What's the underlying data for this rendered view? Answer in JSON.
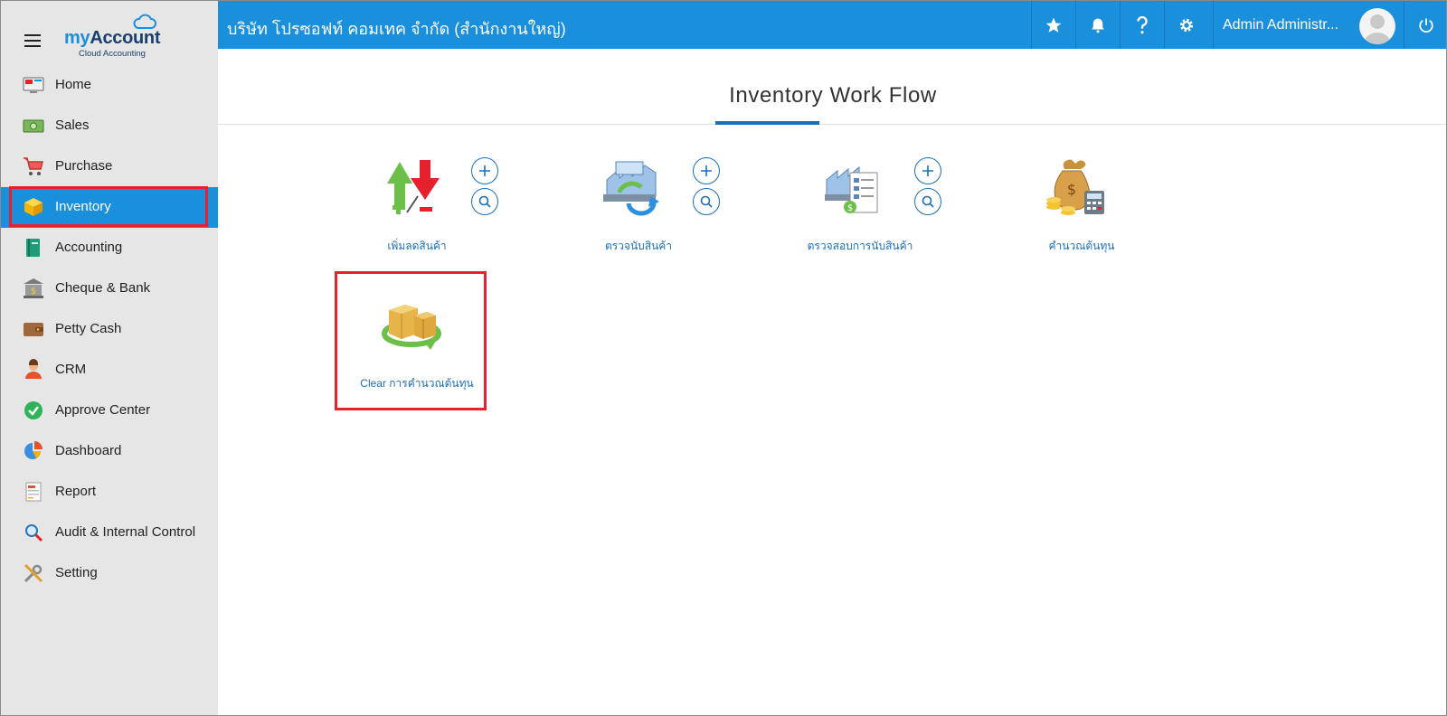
{
  "app": {
    "logo_my": "my",
    "logo_account": "Account",
    "logo_sub": "Cloud Accounting"
  },
  "topbar": {
    "company": "บริษัท โปรซอฟท์ คอมเทค จำกัด (สำนักงานใหญ่)",
    "user_name": "Admin Administr...",
    "accent": "#1a8fdc"
  },
  "sidebar": {
    "items": [
      {
        "label": "Home",
        "icon": "home-monitor-icon"
      },
      {
        "label": "Sales",
        "icon": "money-icon"
      },
      {
        "label": "Purchase",
        "icon": "cart-icon"
      },
      {
        "label": "Inventory",
        "icon": "box-icon",
        "active": true
      },
      {
        "label": "Accounting",
        "icon": "book-icon"
      },
      {
        "label": "Cheque & Bank",
        "icon": "bank-icon"
      },
      {
        "label": "Petty Cash",
        "icon": "wallet-icon"
      },
      {
        "label": "CRM",
        "icon": "people-icon"
      },
      {
        "label": "Approve Center",
        "icon": "check-icon"
      },
      {
        "label": "Dashboard",
        "icon": "pie-chart-icon"
      },
      {
        "label": "Report",
        "icon": "report-icon"
      },
      {
        "label": "Audit & Internal Control",
        "icon": "magnifier-icon"
      },
      {
        "label": "Setting",
        "icon": "tools-icon"
      }
    ]
  },
  "main": {
    "title": "Inventory Work Flow",
    "workflow": [
      {
        "label": "เพิ่มลดสินค้า",
        "icon": "adjust-stock-icon"
      },
      {
        "label": "ตรวจนับสินค้า",
        "icon": "stock-count-icon"
      },
      {
        "label": "ตรวจสอบการนับสินค้า",
        "icon": "verify-count-icon"
      },
      {
        "label": "คำนวณต้นทุน",
        "icon": "cost-calc-icon"
      },
      {
        "label": "Clear การคำนวณต้นทุน",
        "icon": "clear-cost-icon"
      }
    ]
  },
  "highlight_color": "#e5212d"
}
